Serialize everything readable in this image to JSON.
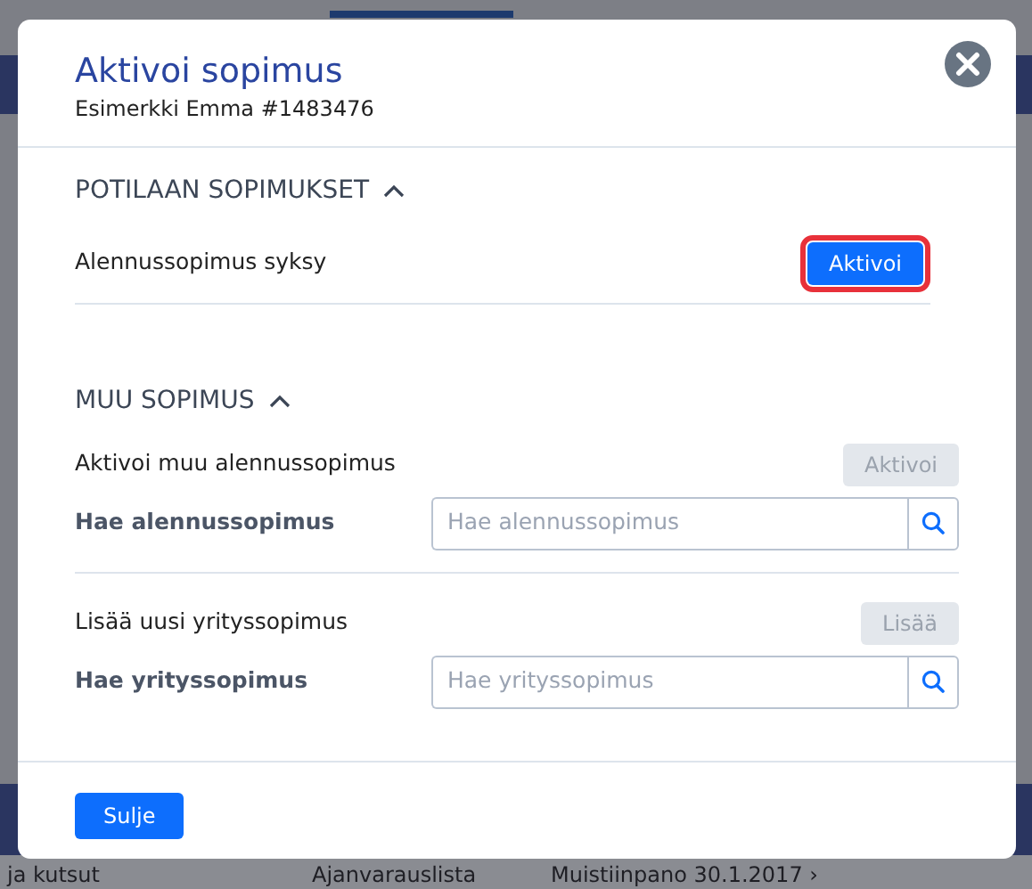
{
  "background": {
    "bottom_texts": [
      "ja kutsut",
      "Ajanvarauslista",
      "Muistiinpano 30.1.2017 ›"
    ]
  },
  "modal": {
    "title": "Aktivoi sopimus",
    "subtitle": "Esimerkki Emma #1483476",
    "sections": [
      {
        "heading": "POTILAAN SOPIMUKSET",
        "expanded": true,
        "rows": [
          {
            "kind": "action",
            "label": "Alennussopimus syksy",
            "button": "Aktivoi",
            "disabled": false,
            "highlighted": true
          }
        ]
      },
      {
        "heading": "MUU SOPIMUS",
        "expanded": true,
        "rows": [
          {
            "kind": "action",
            "label": "Aktivoi muu alennussopimus",
            "button": "Aktivoi",
            "disabled": true,
            "highlighted": false
          },
          {
            "kind": "search",
            "label": "Hae alennussopimus",
            "placeholder": "Hae alennussopimus"
          },
          {
            "kind": "divider"
          },
          {
            "kind": "action",
            "label": "Lisää uusi yrityssopimus",
            "button": "Lisää",
            "disabled": true,
            "highlighted": false
          },
          {
            "kind": "search",
            "label": "Hae yrityssopimus",
            "placeholder": "Hae yrityssopimus"
          }
        ]
      }
    ],
    "close_button": "Sulje"
  }
}
